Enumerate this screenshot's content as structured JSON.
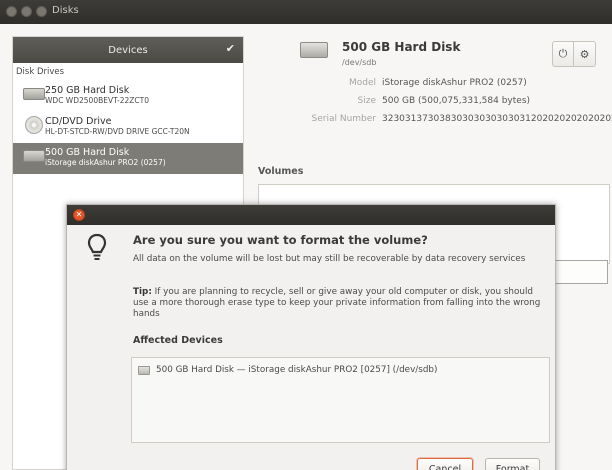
{
  "window": {
    "title": "Disks"
  },
  "sidebar": {
    "header": "Devices",
    "section": "Disk Drives",
    "drives": [
      {
        "name": "250 GB Hard Disk",
        "model": "WDC WD2500BEVT-22ZCT0",
        "icon": "hard-disk-icon"
      },
      {
        "name": "CD/DVD Drive",
        "model": "HL-DT-STCD-RW/DVD DRIVE GCC-T20N",
        "icon": "optical-drive-icon"
      },
      {
        "name": "500 GB Hard Disk",
        "model": "iStorage diskAshur PRO2 (0257)",
        "icon": "usb-disk-icon"
      }
    ]
  },
  "details": {
    "title": "500 GB Hard Disk",
    "path": "/dev/sdb",
    "model_label": "Model",
    "model_value": "iStorage diskAshur PRO2 (0257)",
    "size_label": "Size",
    "size_value": "500 GB (500,075,331,584 bytes)",
    "serial_label": "Serial Number",
    "serial_value": "323031373038303030303030312020202020202020",
    "volumes_label": "Volumes"
  },
  "dialog": {
    "heading": "Are you sure you want to format the volume?",
    "body": "All data on the volume will be lost but may still be recoverable by data recovery services",
    "tip_label": "Tip:",
    "tip_text": " If you are planning to recycle, sell or give away your old computer or disk, you should use a more thorough erase type to keep your private information from falling into the wrong hands",
    "affected_heading": "Affected Devices",
    "affected_item": "500 GB Hard Disk — iStorage diskAshur PRO2 [0257] (/dev/sdb)",
    "cancel_label": "Cancel",
    "format_label": "Format"
  },
  "colors": {
    "accent": "#e0693d",
    "titlebar": "#3d3c38",
    "selection": "#7e7c76"
  }
}
